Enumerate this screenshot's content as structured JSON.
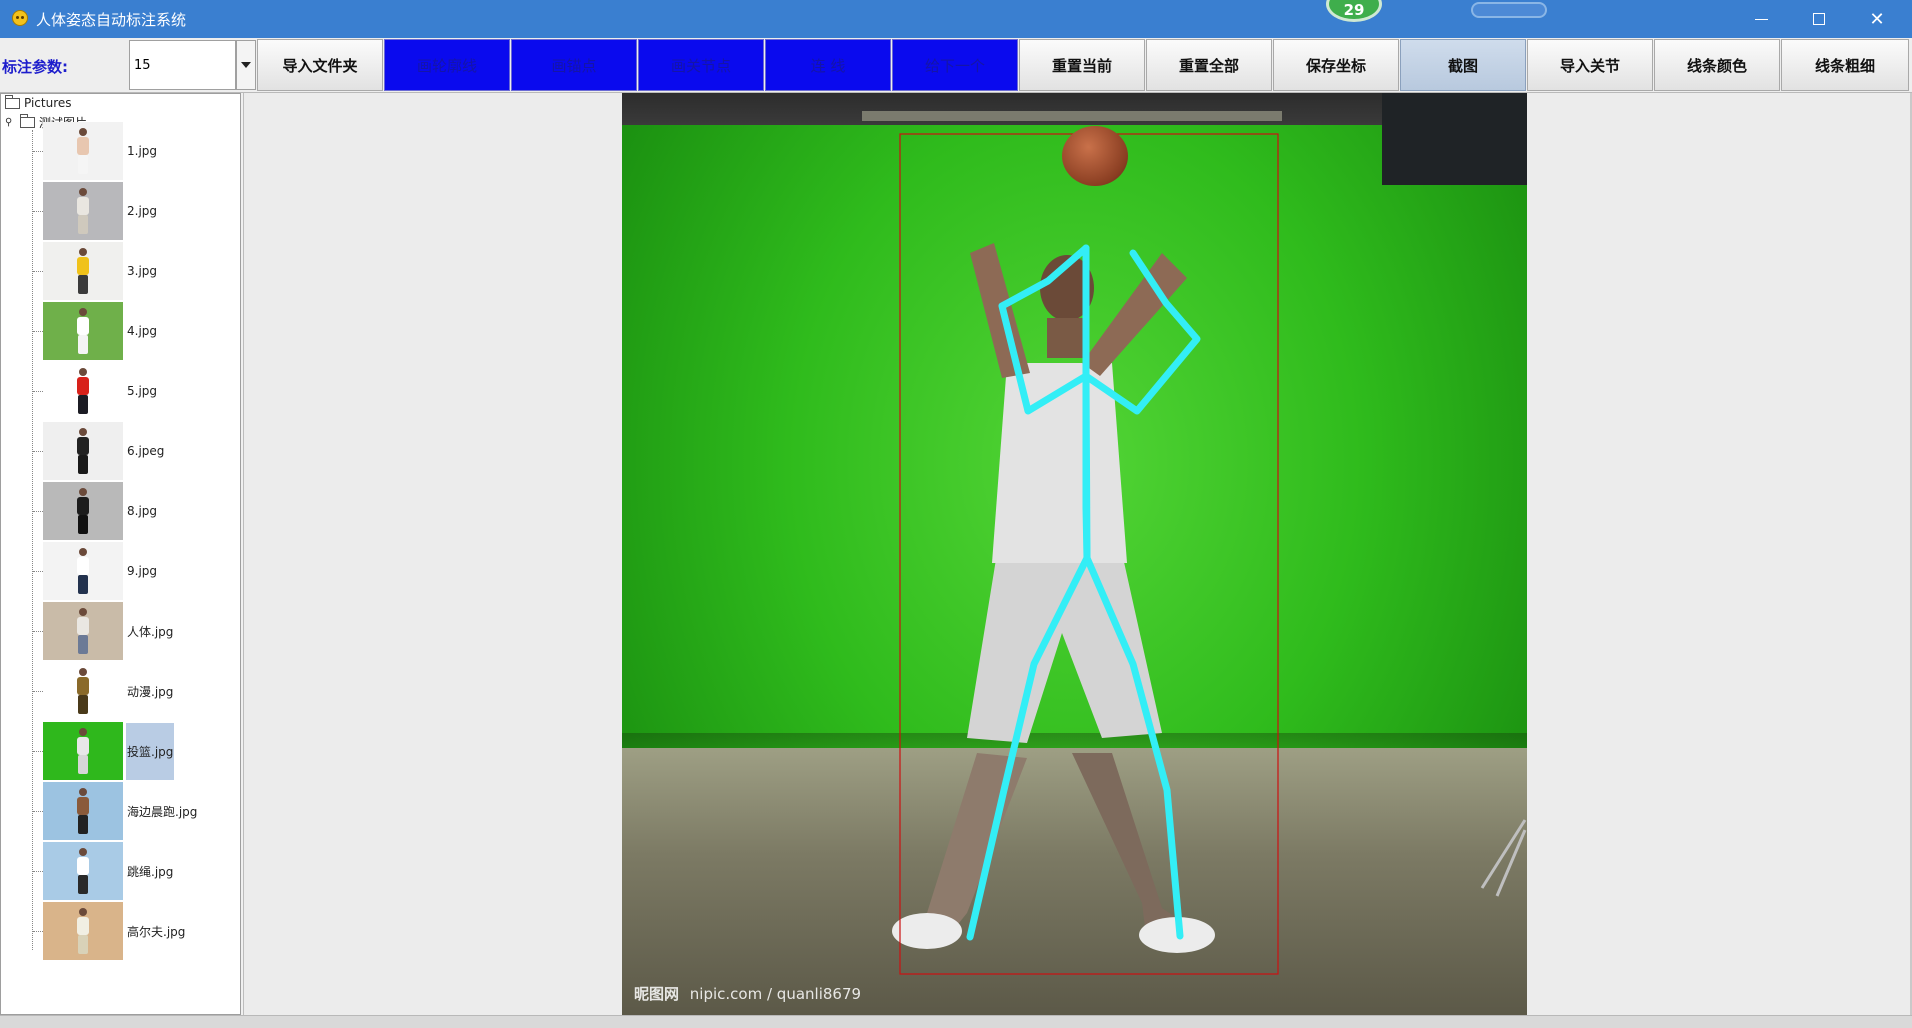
{
  "window": {
    "title": "人体姿态自动标注系统",
    "badge_count": "29",
    "title_bar_color": "#3a7fd0"
  },
  "toolbar": {
    "param_label": "标注参数:",
    "param_value": "15",
    "buttons": [
      {
        "label": "导入文件夹",
        "style": "normal"
      },
      {
        "label": "画轮廓线",
        "style": "blue"
      },
      {
        "label": "画锚点",
        "style": "blue"
      },
      {
        "label": "画关节点",
        "style": "blue"
      },
      {
        "label": "连 线",
        "style": "blue"
      },
      {
        "label": "给下一个",
        "style": "blue"
      },
      {
        "label": "重置当前",
        "style": "normal"
      },
      {
        "label": "重置全部",
        "style": "normal"
      },
      {
        "label": "保存坐标",
        "style": "normal"
      },
      {
        "label": "截图",
        "style": "pressed"
      },
      {
        "label": "导入关节",
        "style": "normal"
      },
      {
        "label": "线条颜色",
        "style": "normal"
      },
      {
        "label": "线条粗细",
        "style": "normal"
      }
    ]
  },
  "tree": {
    "root": "Pictures",
    "folder": "测试图片",
    "files": [
      {
        "name": "1.jpg",
        "bg": "#f2f2f2",
        "shirt": "#e8c7b0",
        "pants": "#f5f5f5"
      },
      {
        "name": "2.jpg",
        "bg": "#b8b8bb",
        "shirt": "#e9e6e0",
        "pants": "#cfc9bd"
      },
      {
        "name": "3.jpg",
        "bg": "#f0f0ee",
        "shirt": "#f0c21a",
        "pants": "#3b3b3b"
      },
      {
        "name": "4.jpg",
        "bg": "#6fb04a",
        "shirt": "#ffffff",
        "pants": "#f4f4f4"
      },
      {
        "name": "5.jpg",
        "bg": "#ffffff",
        "shirt": "#d8211a",
        "pants": "#1c1c24"
      },
      {
        "name": "6.jpeg",
        "bg": "#efefef",
        "shirt": "#222222",
        "pants": "#1a1a1a"
      },
      {
        "name": "8.jpg",
        "bg": "#b9b9b9",
        "shirt": "#1c1c1c",
        "pants": "#111111"
      },
      {
        "name": "9.jpg",
        "bg": "#f3f3f3",
        "shirt": "#ffffff",
        "pants": "#23324e"
      },
      {
        "name": "人体.jpg",
        "bg": "#c9bba8",
        "shirt": "#eae7e2",
        "pants": "#6c7a96"
      },
      {
        "name": "动漫.jpg",
        "bg": "#ffffff",
        "shirt": "#8a6a2a",
        "pants": "#4a3a1a"
      },
      {
        "name": "投篮.jpg",
        "bg": "#2fb81c",
        "shirt": "#e7e7e7",
        "pants": "#d6d6d6",
        "selected": true
      },
      {
        "name": "海边晨跑.jpg",
        "bg": "#9cc3e1",
        "shirt": "#8a5a3a",
        "pants": "#222222"
      },
      {
        "name": "跳绳.jpg",
        "bg": "#a9cbe6",
        "shirt": "#ffffff",
        "pants": "#2a2a2a"
      },
      {
        "name": "高尔夫.jpg",
        "bg": "#d9b48a",
        "shirt": "#f1efe3",
        "pants": "#d9d2b8"
      }
    ]
  },
  "canvas": {
    "watermark_cn": "昵图网",
    "watermark_url": "nipic.com / quanli8679",
    "skeleton_color": "#33eef6",
    "contour_color": "#cc1111"
  }
}
